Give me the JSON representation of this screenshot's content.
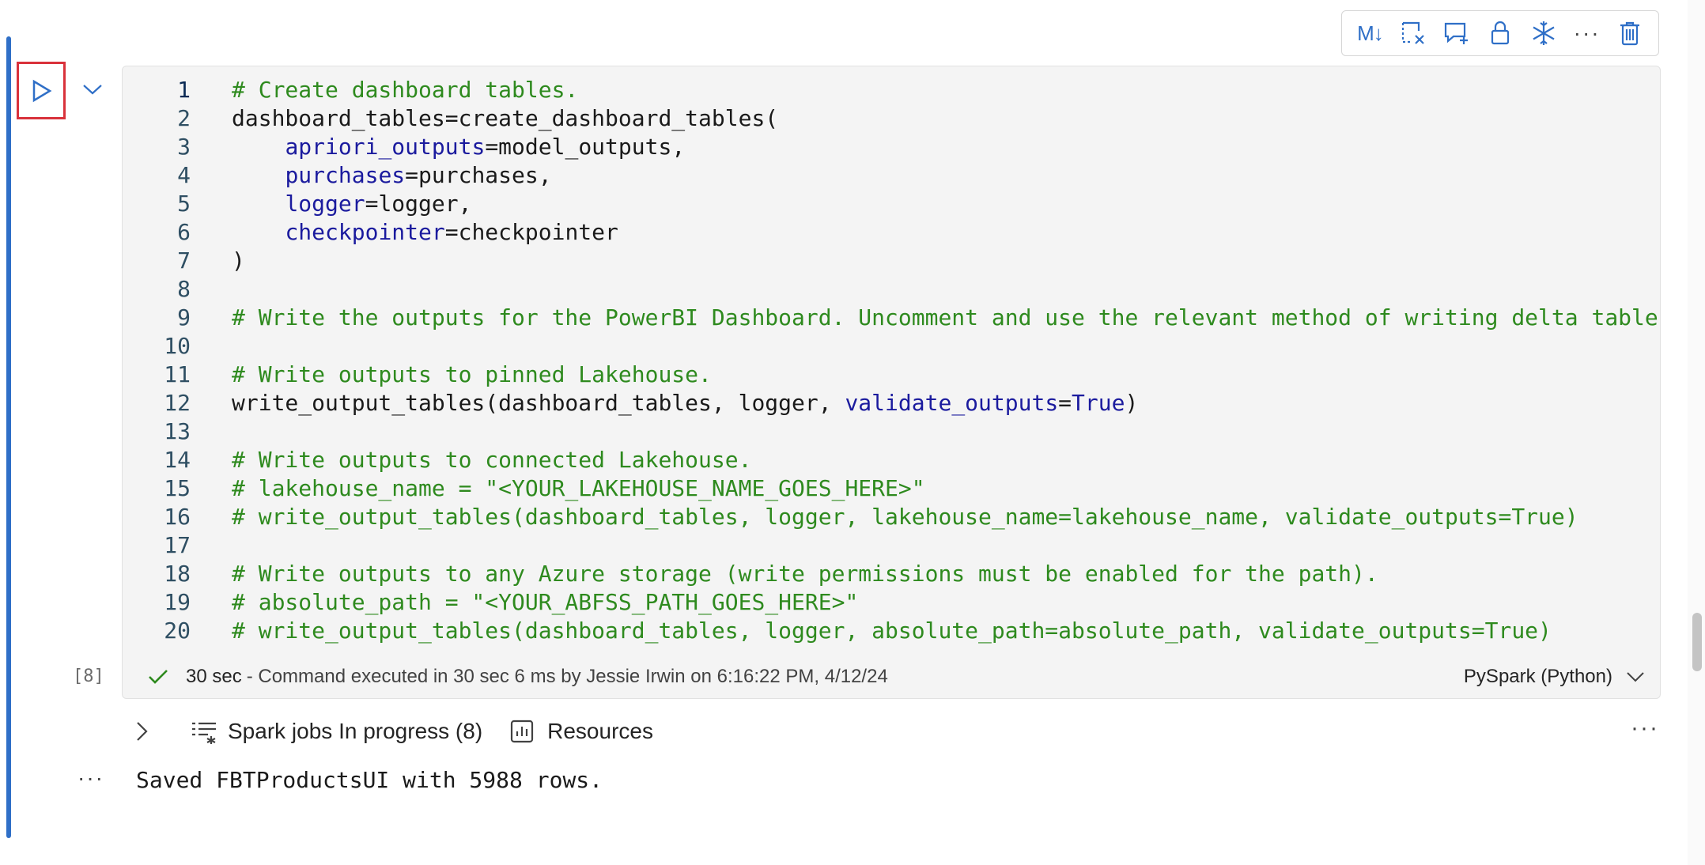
{
  "toolbar": {
    "markdown_label": "M↓",
    "more_label": "···",
    "icons": [
      "markdown-icon",
      "clear-output-icon",
      "add-comment-icon",
      "lock-icon",
      "freeze-icon",
      "more-icon",
      "delete-icon"
    ]
  },
  "cell": {
    "lines": [
      {
        "n": "1",
        "tokens": [
          {
            "t": "# Create dashboard tables.",
            "c": "c"
          }
        ]
      },
      {
        "n": "2",
        "tokens": [
          {
            "t": "dashboard_tables=create_dashboard_tables(",
            "c": ""
          }
        ]
      },
      {
        "n": "3",
        "tokens": [
          {
            "t": "    ",
            "c": ""
          },
          {
            "t": "apriori_outputs",
            "c": "kw"
          },
          {
            "t": "=model_outputs,",
            "c": ""
          }
        ]
      },
      {
        "n": "4",
        "tokens": [
          {
            "t": "    ",
            "c": ""
          },
          {
            "t": "purchases",
            "c": "kw"
          },
          {
            "t": "=purchases,",
            "c": ""
          }
        ]
      },
      {
        "n": "5",
        "tokens": [
          {
            "t": "    ",
            "c": ""
          },
          {
            "t": "logger",
            "c": "kw"
          },
          {
            "t": "=logger,",
            "c": ""
          }
        ]
      },
      {
        "n": "6",
        "tokens": [
          {
            "t": "    ",
            "c": ""
          },
          {
            "t": "checkpointer",
            "c": "kw"
          },
          {
            "t": "=checkpointer",
            "c": ""
          }
        ]
      },
      {
        "n": "7",
        "tokens": [
          {
            "t": ")",
            "c": ""
          }
        ]
      },
      {
        "n": "8",
        "tokens": []
      },
      {
        "n": "9",
        "tokens": [
          {
            "t": "# Write the outputs for the PowerBI Dashboard. Uncomment and use the relevant method of writing delta table",
            "c": "c"
          }
        ]
      },
      {
        "n": "10",
        "tokens": []
      },
      {
        "n": "11",
        "tokens": [
          {
            "t": "# Write outputs to pinned Lakehouse.",
            "c": "c"
          }
        ]
      },
      {
        "n": "12",
        "tokens": [
          {
            "t": "write_output_tables(dashboard_tables, logger, ",
            "c": ""
          },
          {
            "t": "validate_outputs",
            "c": "kw"
          },
          {
            "t": "=",
            "c": ""
          },
          {
            "t": "True",
            "c": "kw"
          },
          {
            "t": ")",
            "c": ""
          }
        ]
      },
      {
        "n": "13",
        "tokens": []
      },
      {
        "n": "14",
        "tokens": [
          {
            "t": "# Write outputs to connected Lakehouse.",
            "c": "c"
          }
        ]
      },
      {
        "n": "15",
        "tokens": [
          {
            "t": "# lakehouse_name = \"<YOUR_LAKEHOUSE_NAME_GOES_HERE>\"",
            "c": "c"
          }
        ]
      },
      {
        "n": "16",
        "tokens": [
          {
            "t": "# write_output_tables(dashboard_tables, logger, lakehouse_name=lakehouse_name, validate_outputs=True)",
            "c": "c"
          }
        ]
      },
      {
        "n": "17",
        "tokens": []
      },
      {
        "n": "18",
        "tokens": [
          {
            "t": "# Write outputs to any Azure storage (write permissions must be enabled for the path).",
            "c": "c"
          }
        ]
      },
      {
        "n": "19",
        "tokens": [
          {
            "t": "# absolute_path = \"<YOUR_ABFSS_PATH_GOES_HERE>\"",
            "c": "c"
          }
        ]
      },
      {
        "n": "20",
        "tokens": [
          {
            "t": "# write_output_tables(dashboard_tables, logger, absolute_path=absolute_path, validate_outputs=True)",
            "c": "c"
          }
        ]
      }
    ],
    "status": {
      "duration": "30 sec",
      "message": "- Command executed in 30 sec 6 ms by Jessie Irwin on 6:16:22 PM, 4/12/24",
      "language": "PySpark (Python)"
    },
    "exec_count": "[8]"
  },
  "output": {
    "spark_jobs_label": "Spark jobs In progress (8)",
    "resources_label": "Resources",
    "more_label": "···",
    "dots_label": "···",
    "text": "Saved FBTProductsUI with 5988 rows."
  },
  "colors": {
    "accent": "#2f6fc7",
    "run_highlight": "#d9323b",
    "comment": "#2e8a1e",
    "keyword": "#1b1b9e"
  }
}
